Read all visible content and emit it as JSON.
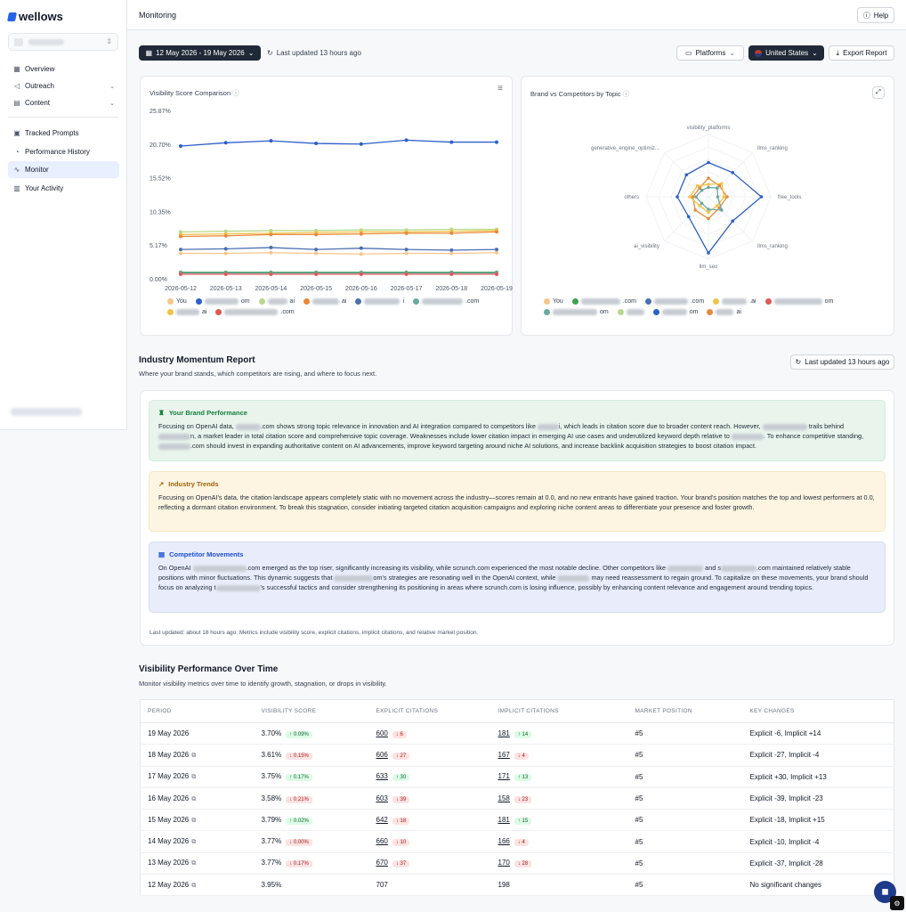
{
  "brand": {
    "name": "wellows"
  },
  "sidebar": {
    "items": [
      {
        "label": "Overview",
        "icon": "grid-icon",
        "active": false
      },
      {
        "label": "Outreach",
        "icon": "megaphone-icon",
        "active": false
      },
      {
        "label": "Content",
        "icon": "document-icon",
        "active": false
      },
      {
        "label": "Tracked Prompts",
        "icon": "prompt-icon",
        "active": false
      },
      {
        "label": "Performance History",
        "icon": "history-icon",
        "active": false
      },
      {
        "label": "Monitor",
        "icon": "activity-icon",
        "active": true
      },
      {
        "label": "Your Activity",
        "icon": "activity-log-icon",
        "active": false
      }
    ]
  },
  "header": {
    "title": "Monitoring",
    "help_label": "Help"
  },
  "toolbar": {
    "date_range": "12 May 2026 - 19 May 2026",
    "last_updated": "Last updated 13 hours ago",
    "platforms_label": "Platforms",
    "country_label": "United States",
    "export_label": "Export Report"
  },
  "visibility_chart": {
    "title": "Visibility Score Comparison"
  },
  "radar_chart": {
    "title": "Brand vs Competitors by Topic"
  },
  "chart_data": [
    {
      "type": "line",
      "title": "Visibility Score Comparison",
      "x": [
        "2026-05-12",
        "2026-05-13",
        "2026-05-14",
        "2026-05-15",
        "2026-05-16",
        "2026-05-17",
        "2026-05-18",
        "2026-05-19"
      ],
      "yticks": [
        "0.00%",
        "5.17%",
        "10.35%",
        "15.52%",
        "20.70%",
        "25.87%"
      ],
      "ylim": [
        0,
        25.87
      ],
      "grid": false,
      "series": [
        {
          "color": "#2c5fc9",
          "values": [
            20.4,
            20.9,
            21.2,
            20.8,
            20.7,
            21.3,
            21.0,
            21.0
          ]
        },
        {
          "color": "#b9d98a",
          "values": [
            7.2,
            7.3,
            7.4,
            7.4,
            7.5,
            7.5,
            7.6,
            7.6
          ]
        },
        {
          "color": "#f0c24a",
          "values": [
            6.8,
            6.9,
            7.0,
            7.1,
            7.2,
            7.2,
            7.3,
            7.4
          ]
        },
        {
          "color": "#e8893a",
          "values": [
            6.5,
            6.6,
            6.8,
            6.8,
            6.9,
            7.0,
            7.0,
            7.2
          ]
        },
        {
          "color": "#4b6fb0",
          "values": [
            4.5,
            4.6,
            4.8,
            4.5,
            4.7,
            4.5,
            4.4,
            4.5
          ]
        },
        {
          "color": "#f5c58c",
          "values": [
            3.9,
            3.9,
            4.0,
            3.9,
            3.8,
            3.9,
            3.9,
            4.0
          ]
        },
        {
          "color": "#3fa34d",
          "values": [
            1.0,
            1.0,
            1.0,
            1.0,
            1.0,
            1.0,
            1.0,
            1.0
          ]
        },
        {
          "color": "#6aa8a0",
          "values": [
            0.9,
            0.9,
            0.9,
            0.9,
            0.9,
            0.9,
            0.9,
            0.9
          ]
        },
        {
          "color": "#e05656",
          "values": [
            0.7,
            0.7,
            0.7,
            0.7,
            0.7,
            0.7,
            0.7,
            0.7
          ]
        }
      ]
    },
    {
      "type": "radar",
      "title": "Brand vs Competitors by Topic",
      "axes": [
        "visibility_platforms",
        "llms_ranking",
        "free_tools",
        "llms_ranking",
        "llm_seo",
        "ai_visibility",
        "others",
        "generative_engine_optimiz..."
      ],
      "series": [
        {
          "color": "#2c5fc9",
          "values": [
            0.55,
            0.55,
            0.85,
            0.55,
            0.9,
            0.45,
            0.5,
            0.5
          ]
        },
        {
          "color": "#e8893a",
          "values": [
            0.3,
            0.25,
            0.3,
            0.25,
            0.35,
            0.3,
            0.25,
            0.2
          ]
        },
        {
          "color": "#f0c24a",
          "values": [
            0.2,
            0.3,
            0.25,
            0.2,
            0.25,
            0.2,
            0.3,
            0.25
          ]
        },
        {
          "color": "#6aa8a0",
          "values": [
            0.15,
            0.2,
            0.15,
            0.3,
            0.2,
            0.15,
            0.2,
            0.15
          ]
        }
      ]
    }
  ],
  "momentum": {
    "title": "Industry Momentum Report",
    "subtitle": "Where your brand stands, which competitors are rising, and where to focus next.",
    "last_updated": "Last updated 13 hours ago",
    "brand_performance": {
      "title": "Your Brand Performance",
      "t1": "Focusing on OpenAI data, ",
      "t2": ".com shows strong topic relevance in innovation and AI integration compared to competitors like ",
      "t3": "i, which leads in citation score due to broader content reach. However, ",
      "t4": " trails behind ",
      "t5": "n, a market leader in total citation score and comprehensive topic coverage. Weaknesses include lower citation impact in emerging AI use cases and underutilized keyword depth relative to ",
      "t6": ". To enhance competitive standing, ",
      "t7": ".com should invest in expanding authoritative content on AI advancements, improve keyword targeting around niche AI solutions, and increase backlink acquisition strategies to boost citation impact."
    },
    "industry_trends": {
      "title": "Industry Trends",
      "text": "Focusing on OpenAI's data, the citation landscape appears completely static with no movement across the industry—scores remain at 0.0, and no new entrants have gained traction. Your brand's position matches the top and lowest performers at 0.0, reflecting a dormant citation environment. To break this stagnation, consider initiating targeted citation acquisition campaigns and exploring niche content areas to differentiate your presence and foster growth."
    },
    "competitor_movements": {
      "title": "Competitor Movements",
      "t1": "On OpenAI ",
      "t2": ".com emerged as the top riser, significantly increasing its visibility, while scrunch.com experienced the most notable decline. Other competitors like ",
      "t3": " and s",
      "t4": ".com maintained relatively stable positions with minor fluctuations. This dynamic suggests that ",
      "t5": "om's strategies are resonating well in the OpenAI context, while ",
      "t6": " may need reassessment to regain ground. To capitalize on these movements, your brand should focus on analyzing t",
      "t7": "'s successful tactics and consider strengthening its positioning in areas where scrunch.com is losing influence, possibly by enhancing content relevance and engagement around trending topics."
    },
    "footnote": "Last updated: about 18 hours ago. Metrics include visibility score, explicit citations, implicit citations, and relative market position."
  },
  "performance": {
    "title": "Visibility Performance Over Time",
    "subtitle": "Monitor visibility metrics over time to identify growth, stagnation, or drops in visibility.",
    "columns": [
      "PERIOD",
      "VISIBILITY SCORE",
      "EXPLICIT CITATIONS",
      "IMPLICIT CITATIONS",
      "MARKET POSITION",
      "KEY CHANGES"
    ],
    "rows": [
      {
        "period": "19 May 2026",
        "score": "3.70%",
        "score_delta": "↑ 0.09%",
        "score_dir": "up",
        "explicit": "600",
        "explicit_delta": "↓ 6",
        "explicit_dir": "down",
        "implicit": "181",
        "implicit_delta": "↑ 14",
        "implicit_dir": "up",
        "position": "#5",
        "changes": "Explicit -6, Implicit +14",
        "ext": false
      },
      {
        "period": "18 May 2026",
        "score": "3.61%",
        "score_delta": "↓ 0.15%",
        "score_dir": "down",
        "explicit": "606",
        "explicit_delta": "↓ 27",
        "explicit_dir": "down",
        "implicit": "167",
        "implicit_delta": "↓ 4",
        "implicit_dir": "down",
        "position": "#5",
        "changes": "Explicit -27, Implicit -4",
        "ext": true
      },
      {
        "period": "17 May 2026",
        "score": "3.75%",
        "score_delta": "↑ 0.17%",
        "score_dir": "up",
        "explicit": "633",
        "explicit_delta": "↑ 30",
        "explicit_dir": "up",
        "implicit": "171",
        "implicit_delta": "↑ 13",
        "implicit_dir": "up",
        "position": "#5",
        "changes": "Explicit +30, Implicit +13",
        "ext": true
      },
      {
        "period": "16 May 2026",
        "score": "3.58%",
        "score_delta": "↓ 0.21%",
        "score_dir": "down",
        "explicit": "603",
        "explicit_delta": "↓ 39",
        "explicit_dir": "down",
        "implicit": "158",
        "implicit_delta": "↓ 23",
        "implicit_dir": "down",
        "position": "#5",
        "changes": "Explicit -39, Implicit -23",
        "ext": true
      },
      {
        "period": "15 May 2026",
        "score": "3.79%",
        "score_delta": "↑ 0.02%",
        "score_dir": "up",
        "explicit": "642",
        "explicit_delta": "↓ 18",
        "explicit_dir": "down",
        "implicit": "181",
        "implicit_delta": "↑ 15",
        "implicit_dir": "up",
        "position": "#5",
        "changes": "Explicit -18, Implicit +15",
        "ext": true
      },
      {
        "period": "14 May 2026",
        "score": "3.77%",
        "score_delta": "↓ 0.00%",
        "score_dir": "down",
        "explicit": "660",
        "explicit_delta": "↓ 10",
        "explicit_dir": "down",
        "implicit": "166",
        "implicit_delta": "↓ 4",
        "implicit_dir": "down",
        "position": "#5",
        "changes": "Explicit -10, Implicit -4",
        "ext": true
      },
      {
        "period": "13 May 2026",
        "score": "3.77%",
        "score_delta": "↓ 0.17%",
        "score_dir": "down",
        "explicit": "670",
        "explicit_delta": "↓ 37",
        "explicit_dir": "down",
        "implicit": "170",
        "implicit_delta": "↓ 28",
        "implicit_dir": "down",
        "position": "#5",
        "changes": "Explicit -37, Implicit -28",
        "ext": true
      },
      {
        "period": "12 May 2026",
        "score": "3.95%",
        "score_delta": "",
        "score_dir": "",
        "explicit": "707",
        "explicit_delta": "",
        "explicit_dir": "",
        "implicit": "198",
        "implicit_delta": "",
        "implicit_dir": "",
        "position": "#5",
        "changes": "No significant changes",
        "ext": true
      }
    ]
  },
  "legend_line": [
    {
      "label": "You",
      "color": "#f5c58c",
      "w": 0
    },
    {
      "label": "",
      "color": "#2c5fc9",
      "w": 38,
      "suffix": "om"
    },
    {
      "label": "",
      "color": "#b9d98a",
      "w": 22,
      "suffix": "ai"
    },
    {
      "label": "",
      "color": "#e8893a",
      "w": 30,
      "suffix": "ai"
    },
    {
      "label": "",
      "color": "#4b6fb0",
      "w": 40,
      "suffix": "i"
    },
    {
      "label": "",
      "color": "#6aa8a0",
      "w": 46,
      "suffix": ".com"
    },
    {
      "label": "",
      "color": "#f0c24a",
      "w": 26,
      "suffix": "ai"
    },
    {
      "label": "",
      "color": "#e05656",
      "w": 60,
      "suffix": ".com"
    }
  ],
  "legend_radar": [
    {
      "label": "You",
      "color": "#f5c58c",
      "w": 0
    },
    {
      "label": "",
      "color": "#3fa34d",
      "w": 44,
      "suffix": ".com"
    },
    {
      "label": "",
      "color": "#4b6fb0",
      "w": 38,
      "suffix": ".com"
    },
    {
      "label": "",
      "color": "#f0c24a",
      "w": 28,
      "suffix": ".ai"
    },
    {
      "label": "",
      "color": "#e05656",
      "w": 54,
      "suffix": "om"
    },
    {
      "label": "",
      "color": "#6aa8a0",
      "w": 50,
      "suffix": "om"
    },
    {
      "label": "",
      "color": "#b9d98a",
      "w": 20,
      "suffix": ""
    },
    {
      "label": "",
      "color": "#2c5fc9",
      "w": 28,
      "suffix": "om"
    },
    {
      "label": "",
      "color": "#e8893a",
      "w": 20,
      "suffix": "ai"
    }
  ]
}
